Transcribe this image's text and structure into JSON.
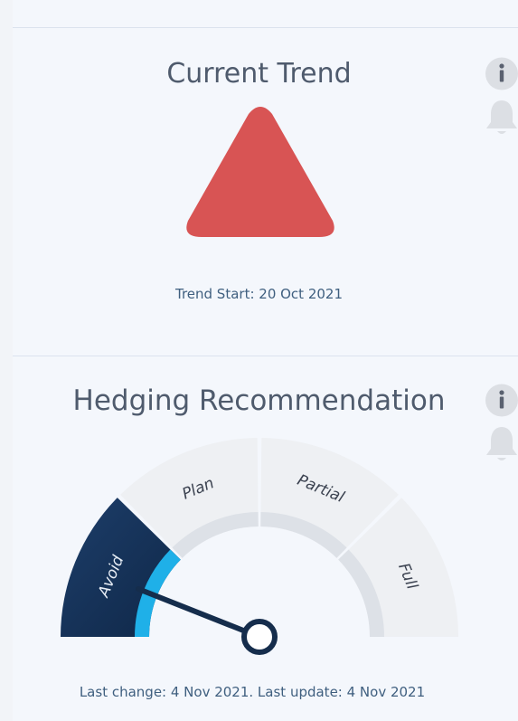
{
  "trend": {
    "title": "Current Trend",
    "direction": "up",
    "indicator_color": "#d85454",
    "start_label": "Trend Start: 20 Oct 2021",
    "info_icon": "info-icon",
    "alert_icon": "bell-icon"
  },
  "hedging": {
    "title": "Hedging Recommendation",
    "segments": [
      "Avoid",
      "Plan",
      "Partial",
      "Full"
    ],
    "active_segment": "Avoid",
    "footer": "Last change: 4 Nov 2021. Last update: 4 Nov 2021",
    "info_icon": "info-icon",
    "alert_icon": "bell-icon"
  },
  "colors": {
    "active": "#17335a",
    "inactive": "#eef0f3",
    "accent": "#1fb0e8",
    "needle": "#152d4c"
  }
}
